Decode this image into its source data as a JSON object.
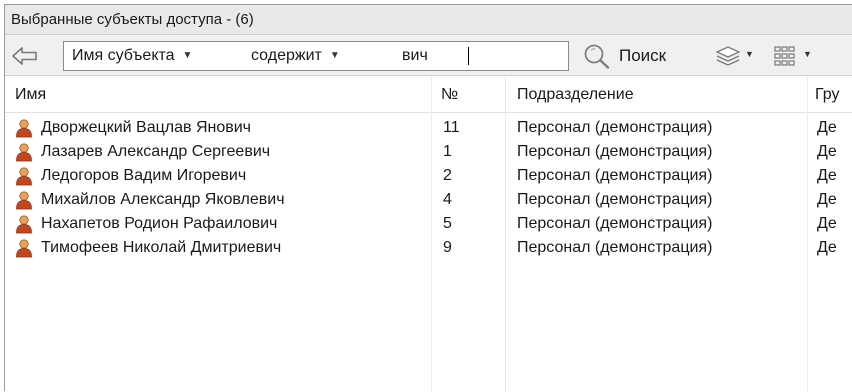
{
  "panel": {
    "title": "Выбранные субъекты доступа - (6)"
  },
  "toolbar": {
    "filter_field": "Имя субъекта",
    "filter_operator": "содержит",
    "filter_value": "вич",
    "search_label": "Поиск"
  },
  "table": {
    "columns": {
      "name": "Имя",
      "num": "№",
      "dept": "Подразделение",
      "group": "Гру"
    },
    "rows": [
      {
        "name": "Дворжецкий Вацлав Янович",
        "num": "11",
        "dept": "Персонал (демонстрация)",
        "group": "Де"
      },
      {
        "name": "Лазарев Александр Сергеевич",
        "num": "1",
        "dept": "Персонал (демонстрация)",
        "group": "Де"
      },
      {
        "name": "Ледогоров Вадим Игоревич",
        "num": "2",
        "dept": "Персонал (демонстрация)",
        "group": "Де"
      },
      {
        "name": "Михайлов Александр Яковлевич",
        "num": "4",
        "dept": "Персонал (демонстрация)",
        "group": "Де"
      },
      {
        "name": "Нахапетов Родион Рафаилович",
        "num": "5",
        "dept": "Персонал (демонстрация)",
        "group": "Де"
      },
      {
        "name": "Тимофеев Николай Дмитриевич",
        "num": "9",
        "dept": "Персонал (демонстрация)",
        "group": "Де"
      }
    ]
  },
  "icons": {
    "back": "arrow-left-icon",
    "search": "magnifier-icon",
    "layers": "layers-icon",
    "grid": "grid-view-icon",
    "user": "user-icon"
  },
  "colors": {
    "header_bg": "#e9e9e9",
    "toolbar_bg": "#f0f0f0",
    "user_icon_head": "#e8a05a",
    "user_icon_body": "#c8461e"
  }
}
